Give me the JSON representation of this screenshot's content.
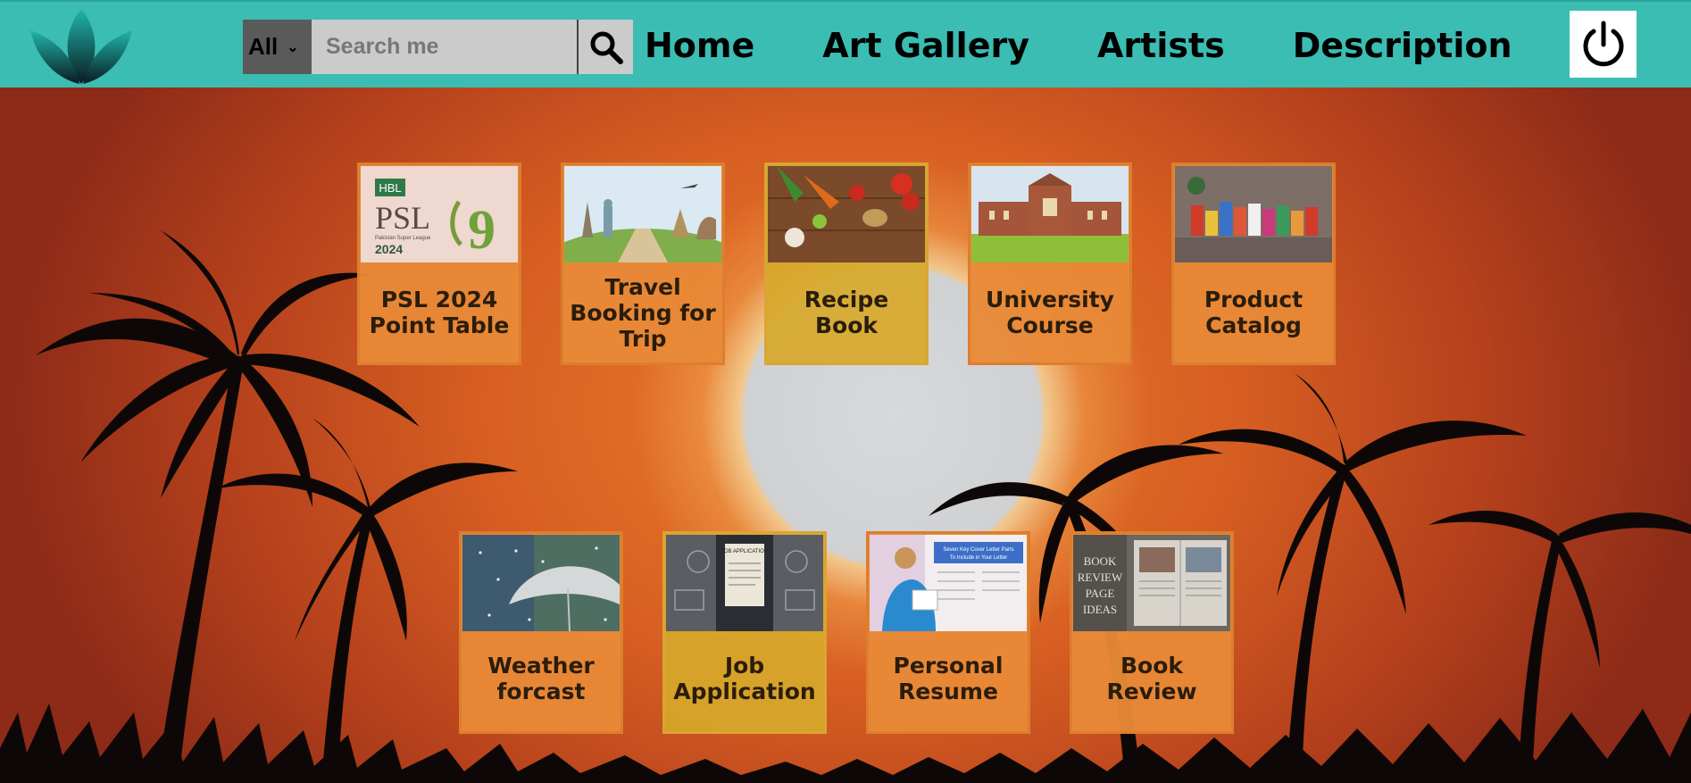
{
  "header": {
    "search": {
      "category": "All",
      "placeholder": "Search me"
    },
    "nav": [
      "Home",
      "Art Gallery",
      "Artists",
      "Description"
    ],
    "logo_icon": "lotus-leaf-logo",
    "power_icon": "power-icon",
    "accent": "#3bbdb3"
  },
  "cards": [
    {
      "title": "PSL 2024 Point Table",
      "style": "orange",
      "image": "psl-2024-logo"
    },
    {
      "title": "Travel Booking for Trip",
      "style": "orange",
      "image": "world-landmarks"
    },
    {
      "title": "Recipe Book",
      "style": "gold",
      "image": "vegetables-on-wood"
    },
    {
      "title": "University Course",
      "style": "orange",
      "image": "university-building"
    },
    {
      "title": "Product Catalog",
      "style": "orange",
      "image": "product-packages"
    },
    {
      "title": "Weather forcast",
      "style": "orange",
      "image": "umbrella-in-rain"
    },
    {
      "title": "Job Application",
      "style": "gold",
      "image": "job-application-form"
    },
    {
      "title": "Personal Resume",
      "style": "orange",
      "image": "cover-letter-infographic"
    },
    {
      "title": "Book Review",
      "style": "orange",
      "image": "book-review-page-ideas"
    }
  ],
  "thumb_text": {
    "psl_hbl": "HBL",
    "psl": "PSL",
    "psl_sub": "Pakistan Super League",
    "psl_year": "2024",
    "psl_nine": "9",
    "job": "JOB APPLICATION",
    "resume_title": "Seven Key Cover Letter Parts",
    "resume_sub": "To Include in Your Letter",
    "book_1": "BOOK",
    "book_2": "REVIEW",
    "book_3": "PAGE",
    "book_4": "IDEAS"
  }
}
